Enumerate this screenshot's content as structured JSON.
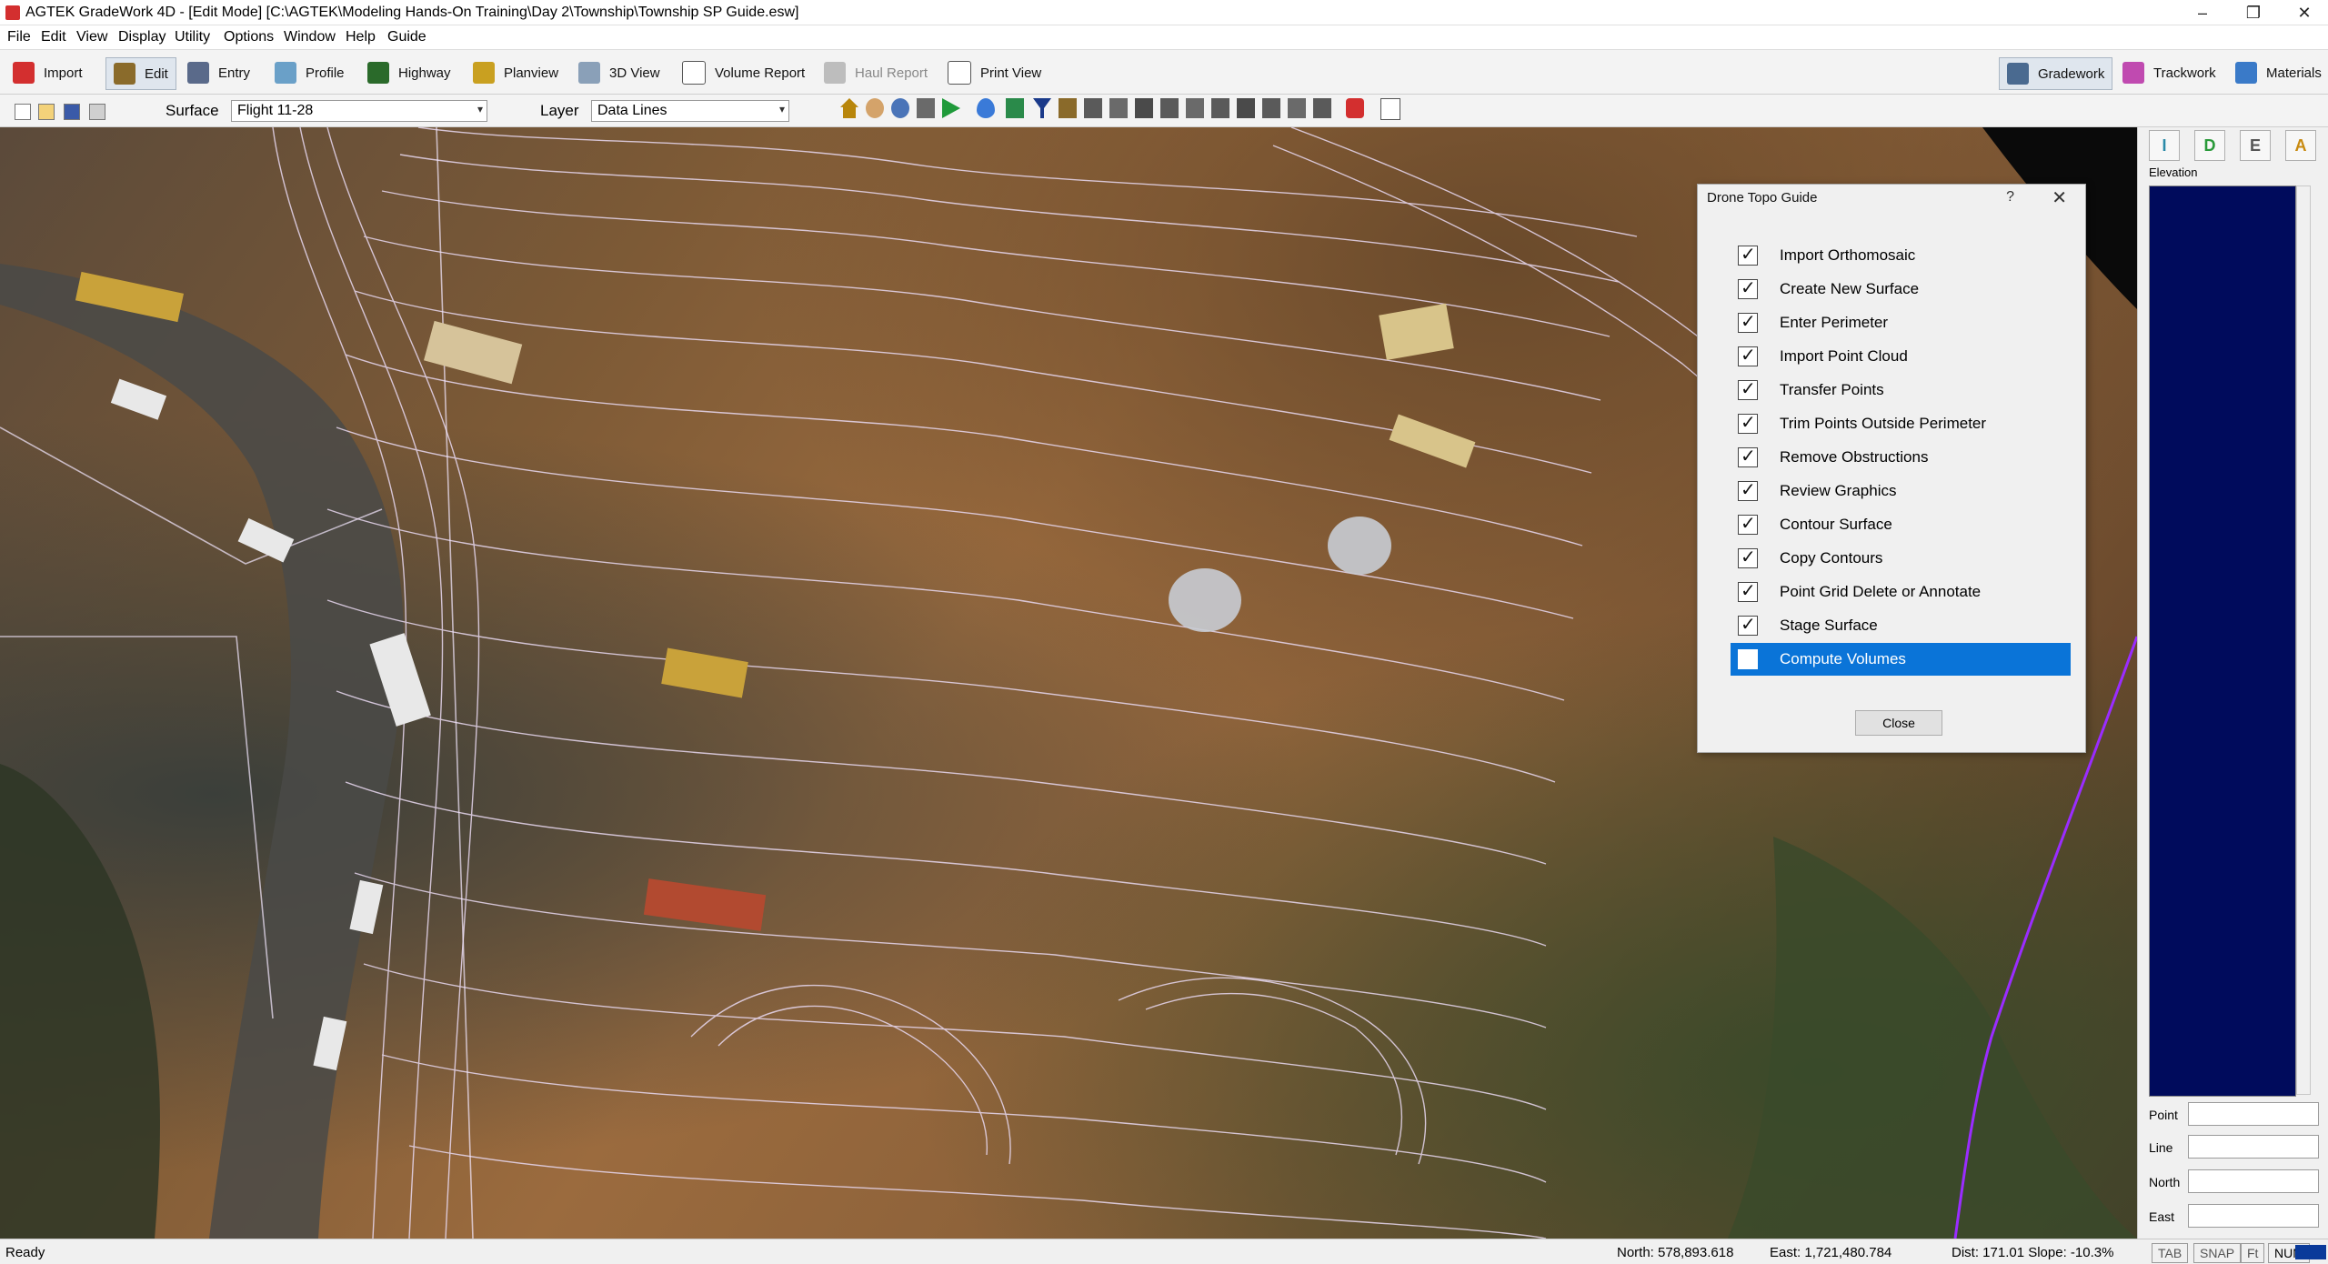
{
  "window": {
    "title": "AGTEK GradeWork 4D - [Edit Mode]  [C:\\AGTEK\\Modeling Hands-On Training\\Day 2\\Township\\Township SP Guide.esw]",
    "minimize": "–",
    "maximize": "❐",
    "close": "✕"
  },
  "menu": [
    "File",
    "Edit",
    "View",
    "Display",
    "Utility",
    "Options",
    "Window",
    "Help",
    "Guide"
  ],
  "toolbar": {
    "import": "Import",
    "edit": "Edit",
    "entry": "Entry",
    "profile": "Profile",
    "highway": "Highway",
    "planview": "Planview",
    "view3d": "3D View",
    "volume_report": "Volume Report",
    "haul_report": "Haul Report",
    "print_view": "Print View",
    "gradework": "Gradework",
    "trackwork": "Trackwork",
    "materials": "Materials"
  },
  "secondary": {
    "surface_label": "Surface",
    "surface_value": "Flight 11-28",
    "layer_label": "Layer",
    "layer_value": "Data Lines"
  },
  "right_panel": {
    "buttons": [
      "I",
      "D",
      "E",
      "A"
    ],
    "elevation_label": "Elevation",
    "fields": [
      "Point",
      "Line",
      "North",
      "East"
    ]
  },
  "dialog": {
    "title": "Drone Topo Guide",
    "help": "?",
    "close_x": "✕",
    "steps": [
      {
        "label": "Import Orthomosaic",
        "checked": true
      },
      {
        "label": "Create New Surface",
        "checked": true
      },
      {
        "label": "Enter Perimeter",
        "checked": true
      },
      {
        "label": "Import Point Cloud",
        "checked": true
      },
      {
        "label": "Transfer Points",
        "checked": true
      },
      {
        "label": "Trim Points Outside Perimeter",
        "checked": true
      },
      {
        "label": "Remove Obstructions",
        "checked": true
      },
      {
        "label": "Review Graphics",
        "checked": true
      },
      {
        "label": "Contour Surface",
        "checked": true
      },
      {
        "label": "Copy Contours",
        "checked": true
      },
      {
        "label": "Point Grid Delete or Annotate",
        "checked": true
      },
      {
        "label": "Stage Surface",
        "checked": true
      },
      {
        "label": "Compute Volumes",
        "checked": false,
        "selected": true
      }
    ],
    "close_button": "Close"
  },
  "status": {
    "ready": "Ready",
    "north": "North: 578,893.618",
    "east": "East: 1,721,480.784",
    "dist_slope": "Dist: 171.01 Slope: -10.3%",
    "indicators": [
      "TAB",
      "SNAP",
      "Ft",
      "NUM"
    ]
  },
  "colors": {
    "selection": "#0a74d8",
    "elevation_bar": "#000b5c",
    "contour": "#e8d8f0",
    "boundary": "#9a2cff"
  }
}
